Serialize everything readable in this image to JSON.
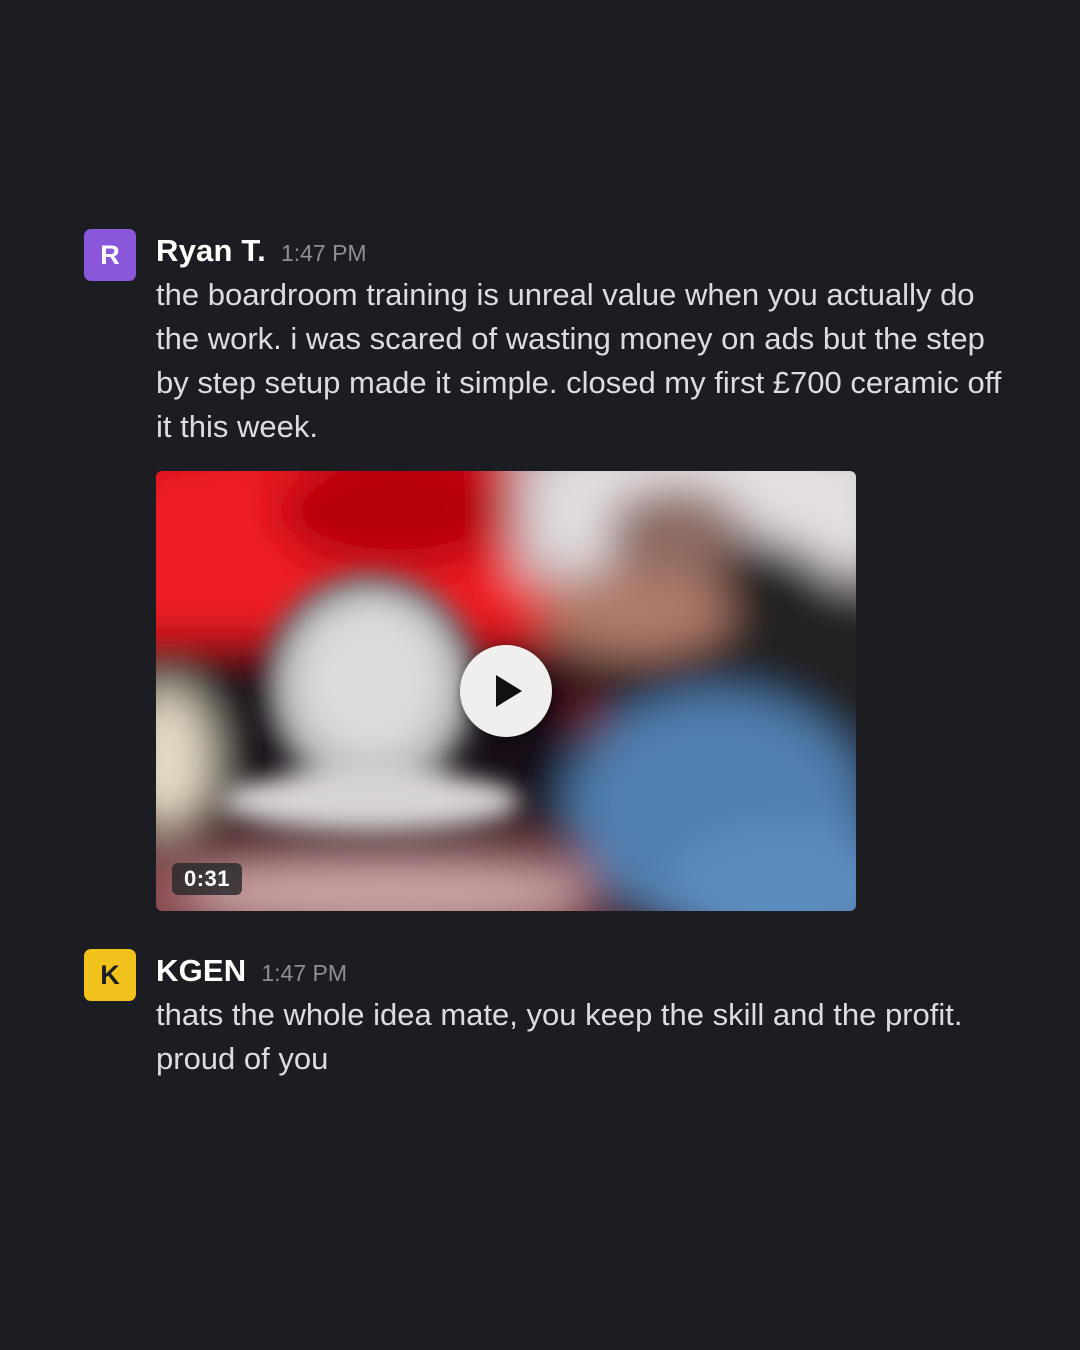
{
  "messages": [
    {
      "avatar_initial": "R",
      "avatar_color": "#8a57db",
      "author": "Ryan T.",
      "timestamp": "1:47 PM",
      "text": "the boardroom training is unreal value when you actually do the work. i was scared of wasting money on ads but the step by step setup made it simple. closed my first £700 ceramic off it this week.",
      "attachment": {
        "type": "video",
        "duration": "0:31",
        "play_icon": "play-icon"
      }
    },
    {
      "avatar_initial": "K",
      "avatar_color": "#f1c21b",
      "author": "KGEN",
      "timestamp": "1:47 PM",
      "text": "thats the whole idea mate, you keep the skill and the profit. proud of you"
    }
  ],
  "colors": {
    "background": "#1b1d22",
    "author_text": "#ffffff",
    "timestamp_text": "#8c8f96",
    "message_text": "#dcdde0"
  }
}
